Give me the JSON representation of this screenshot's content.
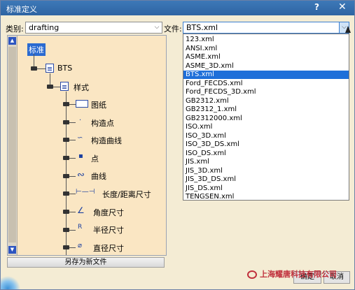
{
  "window": {
    "title": "标准定义",
    "help_glyph": "?",
    "close_glyph": "✕"
  },
  "category": {
    "label": "类别:",
    "value": "drafting"
  },
  "file": {
    "label": "文件:",
    "value": "BTS.xml"
  },
  "dropdown_options": [
    "123.xml",
    "ANSI.xml",
    "ASME.xml",
    "ASME_3D.xml",
    "BTS.xml",
    "Ford_FECDS.xml",
    "Ford_FECDS_3D.xml",
    "GB2312.xml",
    "GB2312_1.xml",
    "GB2312000.xml",
    "ISO.xml",
    "ISO_3D.xml",
    "ISO_3D_DS.xml",
    "ISO_DS.xml",
    "JIS.xml",
    "JIS_3D.xml",
    "JIS_3D_DS.xml",
    "JIS_DS.xml",
    "TENGSEN.xml"
  ],
  "selected_option": "BTS.xml",
  "tree": {
    "root": "标准",
    "level1": "BTS",
    "level2": "样式",
    "items": [
      "图纸",
      "构造点",
      "构造曲线",
      "点",
      "曲线",
      "长度/距离尺寸",
      "角度尺寸",
      "半径尺寸",
      "直径尺寸"
    ]
  },
  "buttons": {
    "save_as": "另存为新文件",
    "ok": "确定",
    "cancel": "取消"
  },
  "watermark": {
    "text": "上海耀唐科技有限公司"
  },
  "colors": {
    "titlebar": "#2e64a3",
    "selection": "#1e6fd9",
    "tree_bg": "#fae6c3",
    "watermark": "#c0303c"
  }
}
